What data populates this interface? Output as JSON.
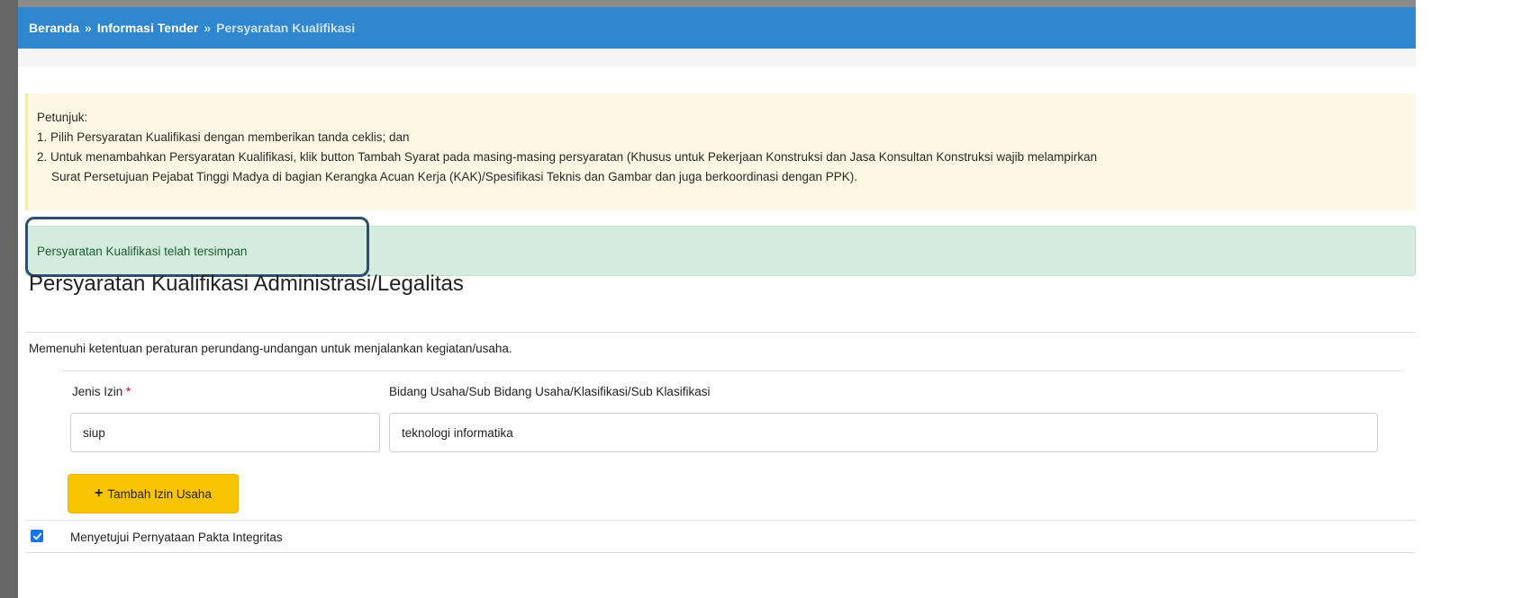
{
  "breadcrumb": {
    "home": "Beranda",
    "separator": "»",
    "tender": "Informasi Tender",
    "current": "Persyaratan Kualifikasi"
  },
  "hint": {
    "title": "Petunjuk:",
    "line1": "1. Pilih Persyaratan Kualifikasi dengan memberikan tanda ceklis; dan",
    "line2": "2. Untuk menambahkan Persyaratan Kualifikasi, klik button Tambah Syarat pada masing-masing persyaratan (Khusus untuk Pekerjaan Konstruksi dan Jasa Konsultan Konstruksi wajib melampirkan",
    "line3": "Surat Persetujuan Pejabat Tinggi Madya di bagian Kerangka Acuan Kerja (KAK)/Spesifikasi Teknis dan Gambar dan juga berkoordinasi dengan PPK)."
  },
  "alert": {
    "message": "Persyaratan Kualifikasi telah tersimpan"
  },
  "section": {
    "title": "Persyaratan Kualifikasi Administrasi/Legalitas",
    "description": "Memenuhi ketentuan peraturan perundang-undangan untuk menjalankan kegiatan/usaha."
  },
  "form": {
    "jenis_izin_label": "Jenis Izin",
    "required_mark": "*",
    "bidang_label": "Bidang Usaha/Sub Bidang Usaha/Klasifikasi/Sub Klasifikasi",
    "jenis_izin_value": "siup",
    "bidang_value": "teknologi informatika",
    "add_button_icon": "+",
    "add_button_label": "Tambah Izin Usaha"
  },
  "agreement": {
    "checked": true,
    "label": "Menyetujui Pernyataan Pakta Integritas"
  },
  "colors": {
    "topbar": "#2f87cf",
    "hint_bg": "#fcf8e3",
    "success_bg": "#d4ecdd",
    "add_button": "#f8c400",
    "checkbox": "#1a73e8"
  }
}
